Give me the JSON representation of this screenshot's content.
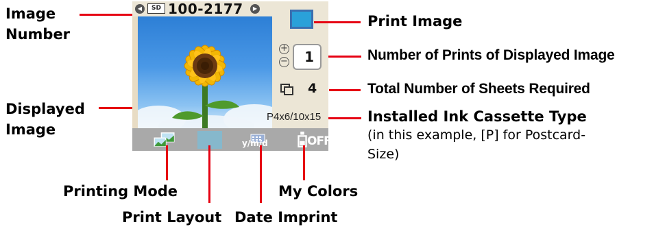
{
  "screen": {
    "image_number": "100-2177",
    "storage_badge": "SD",
    "print_count": "1",
    "total_sheets": "4",
    "ink_cassette": "P4x6/10x15",
    "date_icon_text": "y/m/d",
    "my_colors_status": "OFF",
    "colors": {
      "screen_bg": "#e8dcc4",
      "bottom_bar": "#a9a9a9",
      "print_icon": "#2aa1d9",
      "sky": "#4a98e6",
      "sunflower": "#f2b705"
    }
  },
  "labels": {
    "image_number": [
      "Image",
      "Number"
    ],
    "displayed_image": [
      "Displayed",
      "Image"
    ],
    "print_image": "Print Image",
    "number_of_prints": "Number of Prints of Displayed Image",
    "total_sheets": "Total Number of Sheets Required",
    "ink_cassette_title": "Installed Ink Cassette Type",
    "ink_cassette_note": [
      "(in this example, [P] for Postcard-",
      "Size)"
    ],
    "printing_mode": "Printing Mode",
    "print_layout": "Print Layout",
    "date_imprint": "Date Imprint",
    "my_colors": "My Colors"
  },
  "annotation_color": "#e60012"
}
